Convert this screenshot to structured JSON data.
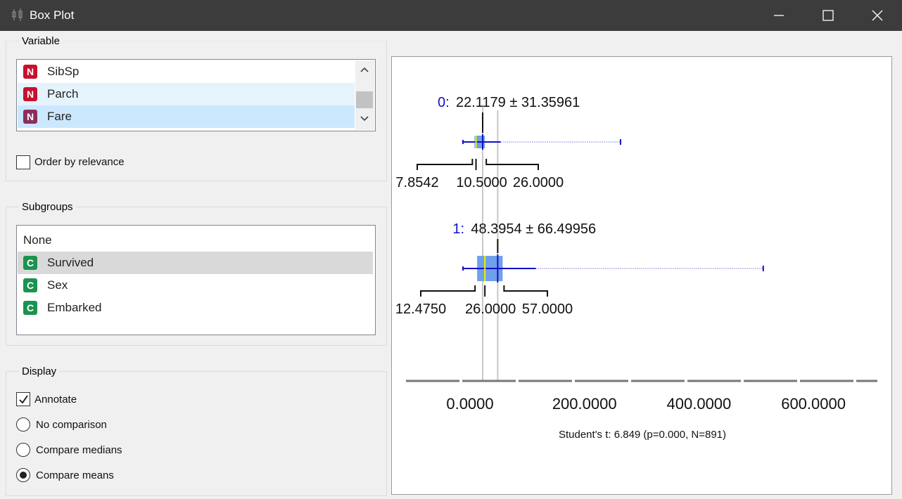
{
  "window": {
    "title": "Box Plot",
    "minimize_icon": "minimize-icon",
    "maximize_icon": "maximize-icon",
    "close_icon": "close-icon"
  },
  "variable_group": {
    "title": "Variable",
    "items": [
      {
        "badge": "N",
        "label": "SibSp",
        "color": "#c8102e"
      },
      {
        "badge": "N",
        "label": "Parch",
        "color": "#c8102e"
      },
      {
        "badge": "N",
        "label": "Fare",
        "color": "#8b2e5e",
        "selected": true
      }
    ],
    "order_by_relevance": {
      "label": "Order by relevance",
      "checked": false
    }
  },
  "subgroups_group": {
    "title": "Subgroups",
    "items": [
      {
        "badge": "",
        "label": "None"
      },
      {
        "badge": "C",
        "label": "Survived",
        "color": "#1a9350",
        "selected": true
      },
      {
        "badge": "C",
        "label": "Sex",
        "color": "#1a9350"
      },
      {
        "badge": "C",
        "label": "Embarked",
        "color": "#1a9350"
      }
    ]
  },
  "display_group": {
    "title": "Display",
    "annotate": {
      "label": "Annotate",
      "checked": true
    },
    "options": [
      {
        "label": "No comparison",
        "selected": false
      },
      {
        "label": "Compare medians",
        "selected": false
      },
      {
        "label": "Compare means",
        "selected": true
      }
    ]
  },
  "chart_data": {
    "type": "boxplot",
    "orientation": "horizontal",
    "xlim": [
      -50,
      650
    ],
    "xticks": [
      0,
      200,
      400,
      600
    ],
    "xtick_labels": [
      "0.0000",
      "200.0000",
      "400.0000",
      "600.0000"
    ],
    "box_color": "#6fa0ea",
    "median_color": "#f0f000",
    "mean_color": "#1010c8",
    "groups": [
      {
        "group_label": "0:",
        "mean_text": "22.1179 ± 31.35961",
        "mean": 22.1179,
        "sd": 31.35961,
        "q1": 7.8542,
        "median": 10.5,
        "q3": 26.0,
        "min": 0.0,
        "max": 263.0,
        "q1_label": "7.8542",
        "median_label": "10.5000",
        "q3_label": "26.0000"
      },
      {
        "group_label": "1:",
        "mean_text": "48.3954 ± 66.49956",
        "mean": 48.3954,
        "sd": 66.49956,
        "q1": 12.475,
        "median": 26.0,
        "q3": 57.0,
        "min": 0.0,
        "max": 512.3292,
        "q1_label": "12.4750",
        "median_label": "26.0000",
        "q3_label": "57.0000"
      }
    ],
    "statistic_text": "Student's t: 6.849 (p=0.000, N=891)"
  }
}
